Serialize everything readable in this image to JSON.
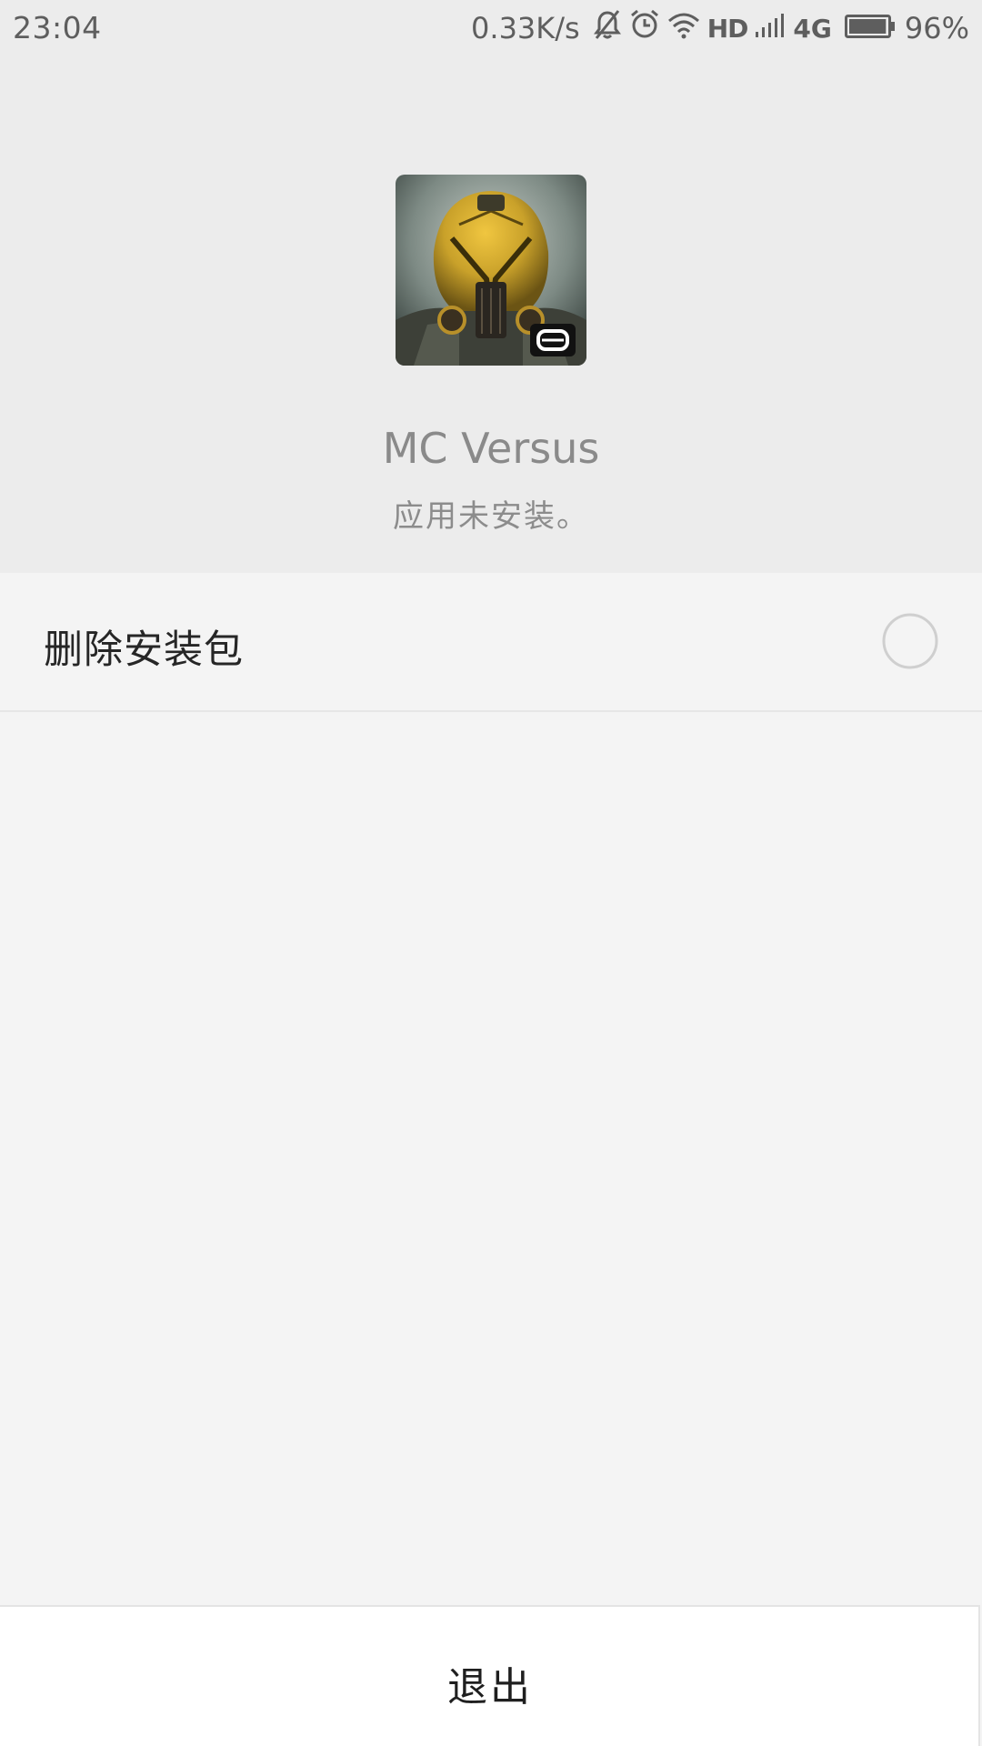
{
  "status_bar": {
    "time": "23:04",
    "net_speed": "0.33K/s",
    "hd": "HD",
    "network": "4G",
    "battery": "96%",
    "battery_level": 0.96,
    "icons": [
      "mute-bell-icon",
      "alarm-clock-icon",
      "wifi-icon",
      "signal-icon",
      "battery-icon"
    ]
  },
  "app": {
    "name": "MC Versus",
    "status": "应用未安装。",
    "icon": "game-helmet-icon"
  },
  "option": {
    "label": "删除安装包",
    "checked": false
  },
  "footer": {
    "exit_label": "退出"
  },
  "colors": {
    "header_bg": "#ececec",
    "body_bg": "#f4f4f4",
    "footer_bg": "#ffffff",
    "helmet_gold": "#c9a12a"
  }
}
